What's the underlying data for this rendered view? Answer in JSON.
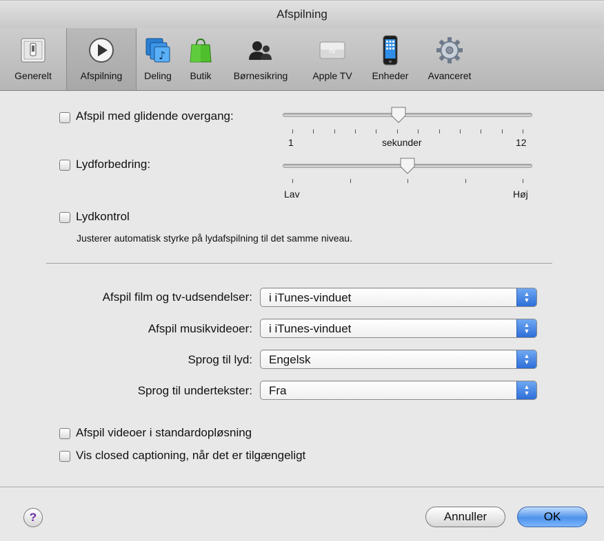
{
  "window": {
    "title": "Afspilning"
  },
  "toolbar": {
    "items": [
      {
        "label": "Generelt",
        "icon": "general-switch-icon"
      },
      {
        "label": "Afspilning",
        "icon": "play-icon"
      },
      {
        "label": "Deling",
        "icon": "sharing-icon"
      },
      {
        "label": "Butik",
        "icon": "shopping-bag-icon"
      },
      {
        "label": "Børnesikring",
        "icon": "parental-icon"
      },
      {
        "label": "Apple TV",
        "icon": "apple-tv-icon"
      },
      {
        "label": "Enheder",
        "icon": "iphone-icon"
      },
      {
        "label": "Avanceret",
        "icon": "gear-icon"
      }
    ],
    "active": "Afspilning"
  },
  "playback": {
    "crossfade": {
      "label": "Afspil med glidende overgang:",
      "checked": false,
      "min_label": "1",
      "mid_label": "sekunder",
      "max_label": "12",
      "value_fraction": 0.46
    },
    "sound_enhancer": {
      "label": "Lydforbedring:",
      "checked": false,
      "min_label": "Lav",
      "max_label": "Høj",
      "value_fraction": 0.5
    },
    "sound_check": {
      "label": "Lydkontrol",
      "checked": false,
      "description": "Justerer automatisk styrke på lydafspilning til det samme niveau."
    }
  },
  "selects": {
    "movies": {
      "label": "Afspil film og tv-udsendelser:",
      "value": "i iTunes-vinduet"
    },
    "music_videos": {
      "label": "Afspil musikvideoer:",
      "value": "i iTunes-vinduet"
    },
    "audio_language": {
      "label": "Sprog til lyd:",
      "value": "Engelsk"
    },
    "subtitle_language": {
      "label": "Sprog til undertekster:",
      "value": "Fra"
    }
  },
  "options": {
    "standard_definition": {
      "label": "Afspil videoer i standardopløsning",
      "checked": false
    },
    "closed_captioning": {
      "label": "Vis closed captioning, når det er tilgængeligt",
      "checked": false
    }
  },
  "footer": {
    "help_label": "?",
    "cancel_label": "Annuller",
    "ok_label": "OK"
  },
  "colors": {
    "accent": "#3d82e6",
    "help": "#6a2aa8"
  }
}
